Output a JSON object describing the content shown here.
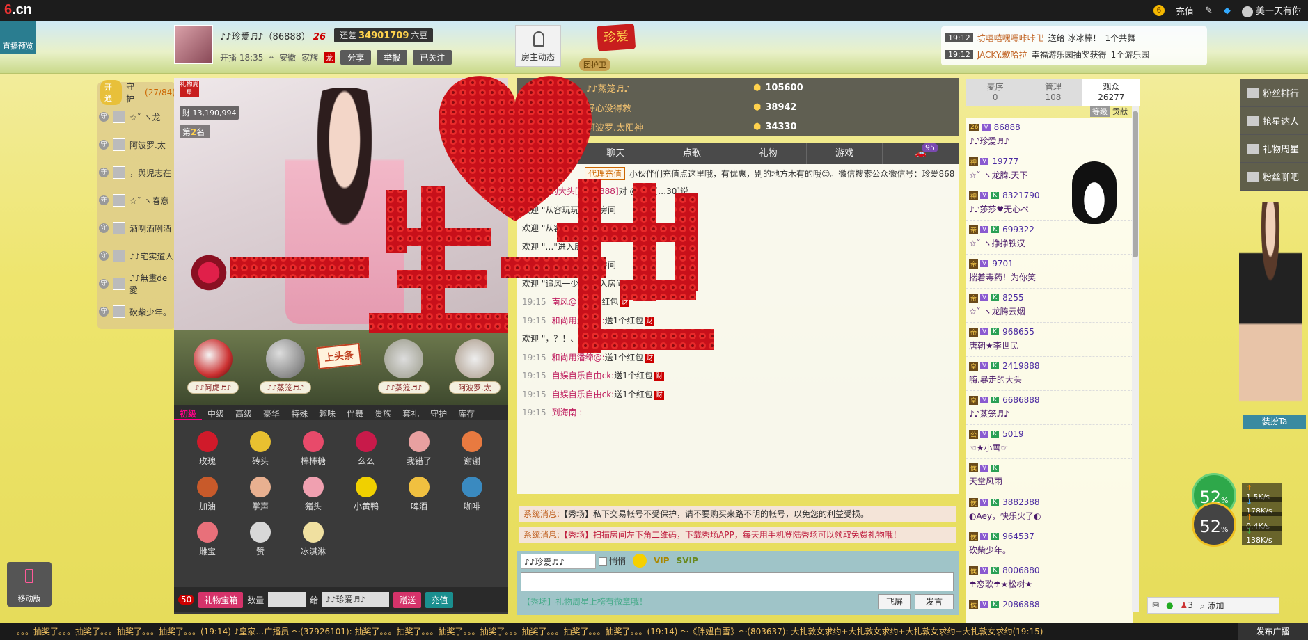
{
  "topbar": {
    "logo": "6.cn",
    "recharge": "充值",
    "username": "美一天有你",
    "coin": "6"
  },
  "preview": "直播预览",
  "host": {
    "name": "♪♪珍爱♬♪（86888）",
    "level_badge": "26",
    "time": "开播 18:35",
    "location": "安徽",
    "family_label": "家族",
    "family_tag": "龙",
    "share": "分享",
    "report": "举报",
    "followed": "已关注"
  },
  "diff": {
    "prefix": "还差",
    "value": "34901709",
    "suffix": "六豆"
  },
  "room_dynamic": "房主动态",
  "zhenai_badge": "珍爱",
  "guardian_label": "团护卫",
  "gift_ticker": [
    {
      "time": "19:12",
      "user": "坊嘻嘻嘿嘿咔咔卍",
      "text": "送给 冰冰棒！",
      "count": "1个共舞"
    },
    {
      "time": "19:12",
      "user": "JACKY.歉哈拉",
      "text": "幸福游乐园抽奖获得",
      "count": "1个游乐园"
    }
  ],
  "guard": {
    "open": "开通",
    "title": "守护",
    "count": "(27/84)",
    "items": [
      "☆ˇ ヽ龙",
      "阿波罗.太",
      "，舆児志在",
      "☆ˇ ヽ春意",
      "酒咧酒咧酒",
      "♪♪宅实道人",
      "♪♪無畫de愛",
      "砍柴少年。"
    ]
  },
  "video": {
    "week_star": "礼物周星",
    "wealth": "13,190,994",
    "rank_prefix": "第",
    "rank": "2",
    "rank_suffix": "名"
  },
  "top_fans": [
    "♪♪阿虎♬♪",
    "♪♪蒸笼♬♪",
    "♪♪蒸笼♬♪",
    "阿波罗.太"
  ],
  "headline": "上头条",
  "gift_tabs": [
    "初级",
    "中级",
    "高级",
    "豪华",
    "特殊",
    "趣味",
    "伴舞",
    "贵族",
    "套礼",
    "守护",
    "库存"
  ],
  "gifts": [
    {
      "name": "玫瑰",
      "color": "#d01a2a"
    },
    {
      "name": "砖头",
      "color": "#e8c030"
    },
    {
      "name": "棒棒糖",
      "color": "#e84a6a"
    },
    {
      "name": "么么",
      "color": "#c81a4a"
    },
    {
      "name": "我错了",
      "color": "#e8a0a0"
    },
    {
      "name": "谢谢",
      "color": "#e87a40"
    },
    {
      "name": "加油",
      "color": "#c85a2a"
    },
    {
      "name": "掌声",
      "color": "#e8b090"
    },
    {
      "name": "猪头",
      "color": "#f0a0b0"
    },
    {
      "name": "小黄鸭",
      "color": "#f0d000"
    },
    {
      "name": "啤酒",
      "color": "#f0c040"
    },
    {
      "name": "咖啡",
      "color": "#3a8ac0"
    },
    {
      "name": "雌宝",
      "color": "#e8707a"
    },
    {
      "name": "赞",
      "color": "#d8d8d8"
    },
    {
      "name": "冰淇淋",
      "color": "#f0e0a0"
    }
  ],
  "gift_bar": {
    "badge": "50",
    "box": "礼物宝箱",
    "qty_label": "数量",
    "give_label": "给",
    "target": "♪♪珍爱♬♪",
    "send": "赠送",
    "recharge": "充值"
  },
  "rankboard": [
    {
      "name": "♪♪蒸笼♬♪",
      "value": "105600"
    },
    {
      "name": "好心没得救",
      "value": "38942"
    },
    {
      "name": "阿波罗.太阳神",
      "value": "34330"
    }
  ],
  "chat_tabs": [
    "聊天",
    "点歌",
    "礼物",
    "游戏"
  ],
  "chat_badge": "95",
  "promo": {
    "btn": "代理充值",
    "text": "小伙伴们充值点这里哦，有优惠，别的地方木有的哦☺。微信搜索公众微信号：珍爱868"
  },
  "chat": [
    {
      "time": "",
      "user": "嗨.暴走的大头[2419888]",
      "text": "对 @背包[…30]说"
    },
    {
      "time": "",
      "user": "",
      "text": "欢迎 \"从容玩玩\"进入房间"
    },
    {
      "time": "",
      "user": "",
      "text": "欢迎 \"从容玩玩\"进入房间"
    },
    {
      "time": "",
      "user": "",
      "text": "欢迎 \"…\"进入房间"
    },
    {
      "time": "",
      "user": "",
      "text": "欢迎 \"此情要追\"进入房间"
    },
    {
      "time": "",
      "user": "",
      "text": "欢迎 \"追风一少年\"进入房间"
    },
    {
      "time": "19:15",
      "user": "南风@:",
      "text": "送1个红包"
    },
    {
      "time": "19:15",
      "user": "和尚用潘缔@:",
      "text": "送1个红包"
    },
    {
      "time": "",
      "user": "",
      "text": "欢迎 \"，？！、\"进入房间"
    },
    {
      "time": "19:15",
      "user": "和尚用潘缔@:",
      "text": "送1个红包"
    },
    {
      "time": "19:15",
      "user": "自娱自乐自由ck:",
      "text": "送1个红包"
    },
    {
      "time": "19:15",
      "user": "自娱自乐自由ck:",
      "text": "送1个红包"
    },
    {
      "time": "19:15",
      "user": "到海南 :",
      "text": ""
    }
  ],
  "gift_flag": "财",
  "sys_msgs": [
    {
      "label": "系统消息:",
      "text": "【秀场】私下交易帐号不受保护，请不要购买来路不明的帐号，以免您的利益受损。"
    },
    {
      "label": "系统消息:",
      "text": "【秀场】扫描房间左下角二维码，下载秀场APP，每天用手机登陆秀场可以领取免费礼物哦！"
    }
  ],
  "chat_input": {
    "target": "♪♪珍爱♬♪",
    "whisper": "悄悄",
    "notice": "【秀场】礼物周星上榜有微章哦！",
    "fly": "飞屏",
    "send": "发言"
  },
  "aud_tabs": [
    {
      "label": "麦序",
      "count": "0"
    },
    {
      "label": "管理",
      "count": "108"
    },
    {
      "label": "观众",
      "count": "26277"
    }
  ],
  "aud_sort": [
    "等级",
    "贡献"
  ],
  "audience": [
    {
      "level": "26",
      "id": "86888",
      "name": "♪♪珍爱♬♪",
      "k": false
    },
    {
      "level": "神",
      "id": "19777",
      "name": "☆ˇ ヽ龙腾.天下",
      "k": false
    },
    {
      "level": "神",
      "id": "8321790",
      "name": "♪♪莎莎♥无心ペ",
      "k": true
    },
    {
      "level": "帝",
      "id": "699322",
      "name": "☆ˇ ヽ挣挣铁汉",
      "k": true
    },
    {
      "level": "帝",
      "id": "9701",
      "name": "揣着毒药！为你笑",
      "k": false
    },
    {
      "level": "帝",
      "id": "8255",
      "name": "☆ˇ ヽ龙腾云烟",
      "k": true
    },
    {
      "level": "帝",
      "id": "968655",
      "name": "唐朝★李世民",
      "k": true
    },
    {
      "level": "皇",
      "id": "2419888",
      "name": "嗨.暴走的大头",
      "k": true
    },
    {
      "level": "皇",
      "id": "6686888",
      "name": "♪♪蒸笼♬♪",
      "k": true
    },
    {
      "level": "公",
      "id": "5019",
      "name": "☜★小雪☞",
      "k": true
    },
    {
      "level": "侯",
      "id": "",
      "name": "天堂风雨",
      "k": true
    },
    {
      "level": "侯",
      "id": "3882388",
      "name": "◐Aey，快乐火了◐",
      "k": true
    },
    {
      "level": "侯",
      "id": "964537",
      "name": "砍柴少年。",
      "k": true
    },
    {
      "level": "侯",
      "id": "8006880",
      "name": "☂恋歌☂★松树★",
      "k": true
    },
    {
      "level": "侯",
      "id": "2086888",
      "name": "",
      "k": true
    }
  ],
  "side_nav": [
    "粉丝排行",
    "抢星达人",
    "礼物周星",
    "粉丝聊吧"
  ],
  "dress_up": "装扮Ta",
  "network": {
    "percent1": "52",
    "percent2": "52",
    "up1": "1.5K/s",
    "down1": "178K/s",
    "up2": "0.4K/s",
    "down2": "138K/s"
  },
  "mobile": "移动版",
  "br_tools": {
    "count": "3",
    "add": "添加"
  },
  "broadcast": "。。。抽奖了。。。抽奖了。。。抽奖了。。。抽奖了。。。(19:14)    ♪皇家…广播员 ～(37926101): 抽奖了。。。抽奖了。。。抽奖了。。。抽奖了。。。抽奖了。。。抽奖了。。。抽奖了。。。(19:14)    ～《胖妞白雪》～(803637): 大扎敦女求约+大扎敦女求约+大扎敦女求约+大扎敦女求约(19:15)",
  "broadcast_btn": "发布广播",
  "overlay_text": [
    "一",
    "生",
    "一",
    "世"
  ]
}
